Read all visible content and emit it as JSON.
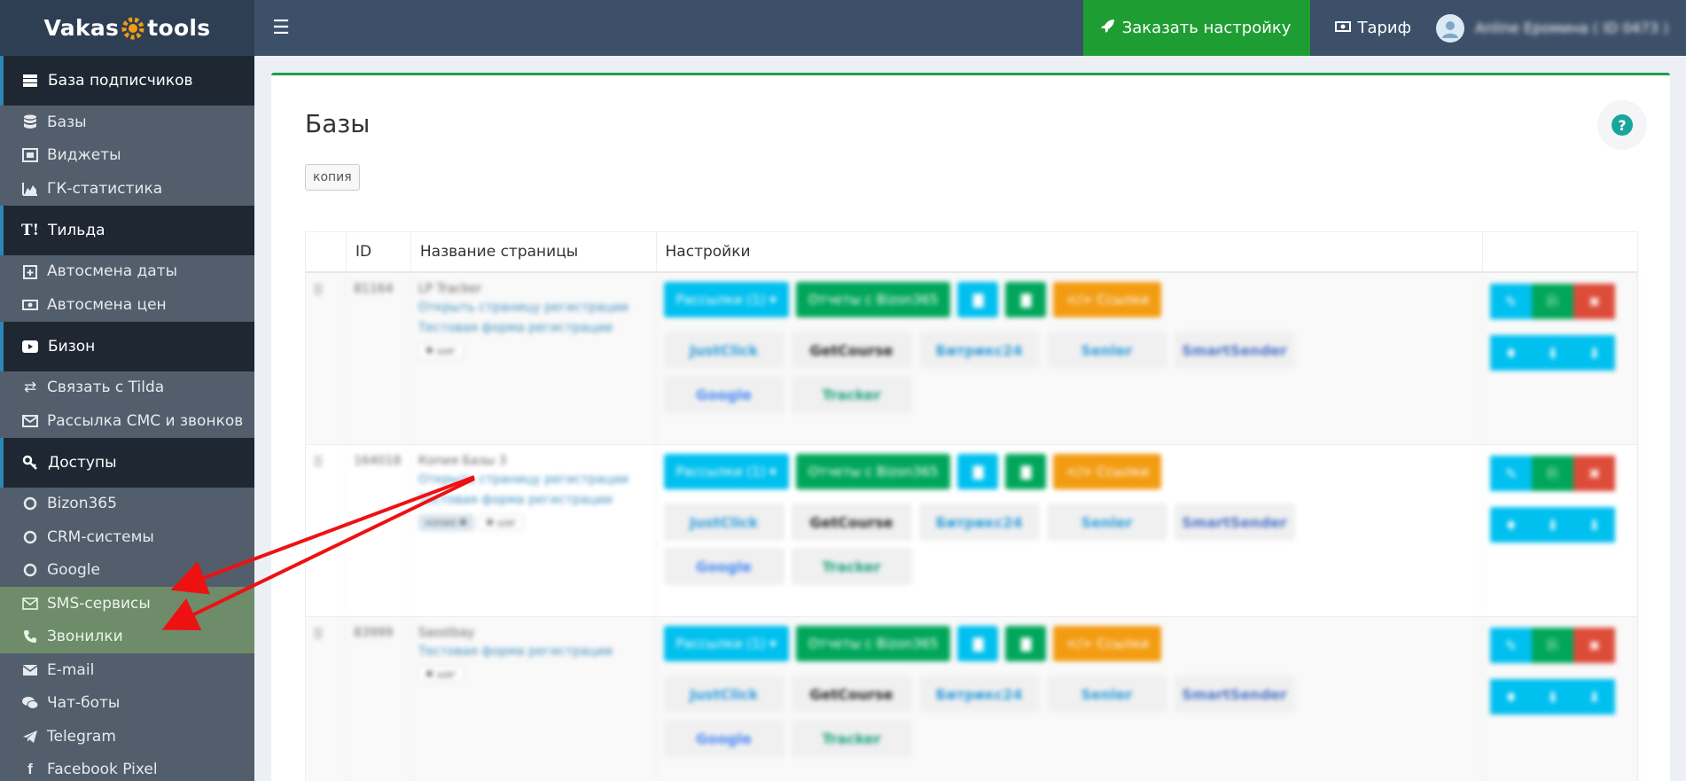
{
  "header": {
    "logo_left": "Vakas",
    "logo_right": "tools",
    "order_button": "Заказать настройку",
    "tariff": "Тариф",
    "user_name": "Anline Еромина ( ID 0473 )"
  },
  "sidebar": {
    "sections": [
      {
        "title": "База подписчиков",
        "icon": "database-icon",
        "items": [
          {
            "label": "Базы",
            "icon": "database-icon"
          },
          {
            "label": "Виджеты",
            "icon": "widget-icon"
          },
          {
            "label": "ГК-статистика",
            "icon": "area-chart-icon"
          }
        ]
      },
      {
        "title": "Тильда",
        "icon": "tilda-icon",
        "items": [
          {
            "label": "Автосмена даты",
            "icon": "calendar-plus-icon"
          },
          {
            "label": "Автосмена цен",
            "icon": "money-icon"
          }
        ]
      },
      {
        "title": "Бизон",
        "icon": "youtube-icon",
        "items": [
          {
            "label": "Связать с Tilda",
            "icon": "exchange-icon"
          },
          {
            "label": "Рассылка СМС и звонков",
            "icon": "envelope-icon"
          }
        ]
      },
      {
        "title": "Доступы",
        "icon": "key-icon",
        "items": [
          {
            "label": "Bizon365",
            "icon": "circle-icon"
          },
          {
            "label": "CRM-системы",
            "icon": "circle-icon"
          },
          {
            "label": "Google",
            "icon": "circle-icon"
          },
          {
            "label": "SMS-сервисы",
            "icon": "envelope-icon"
          },
          {
            "label": "Звонилки",
            "icon": "phone-icon"
          },
          {
            "label": "E-mail",
            "icon": "envelope-icon"
          },
          {
            "label": "Чат-боты",
            "icon": "chat-icon"
          },
          {
            "label": "Telegram",
            "icon": "telegram-icon"
          },
          {
            "label": "Facebook Pixel",
            "icon": "facebook-icon"
          }
        ]
      }
    ]
  },
  "main": {
    "title": "Базы",
    "copy_button": "копия",
    "columns": [
      "",
      "ID",
      "Название страницы",
      "Настройки",
      ""
    ],
    "buttons": {
      "mailings": "Рассылки (1) ▾",
      "reports": "Отчеты с Bizon365",
      "links": "</> Ссылки"
    },
    "services": [
      "JustClick",
      "GetCourse",
      "Битрикс24",
      "Senler",
      "SmartSender",
      "Google",
      "Tracker"
    ],
    "rows": [
      {
        "id": "81164",
        "name": "LP Tracker",
        "links": [
          "Открыть страницу регистрации",
          "Тестовая форма регистрации"
        ],
        "tags": [
          "✖ шаг"
        ]
      },
      {
        "id": "164018",
        "name": "Копия Базы 3",
        "links": [
          "Открыть страницу регистрации",
          "Тестовая форма регистрации"
        ],
        "tags": [
          "копия ✖",
          "✖ шаг"
        ]
      },
      {
        "id": "83999",
        "name": "Sasstbay",
        "links": [
          "Тестовая форма регистрации"
        ],
        "tags": [
          "✖ шаг"
        ]
      }
    ]
  },
  "colors": {
    "header_bg": "#3c5069",
    "sidebar_bg": "#525e6b",
    "sidebar_section_bg": "#1f2733",
    "highlight": "#6e8c6a",
    "order_green": "#1e9e32",
    "arrow": "#ee1111"
  }
}
